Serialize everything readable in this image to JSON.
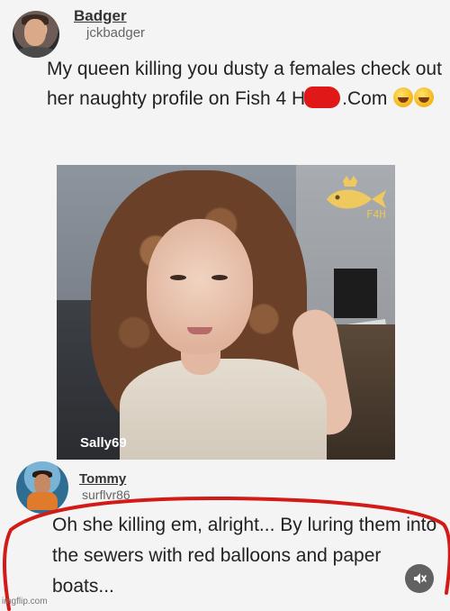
{
  "post": {
    "author": {
      "display_name": "Badger",
      "handle": "jckbadger"
    },
    "text_before_redaction": "My queen killing you dusty a females check out her naughty profile on Fish 4 H",
    "text_after_redaction": ".Com",
    "photo": {
      "username_label": "Sally69",
      "logo_text": "F4H",
      "logo_icon": "fish-crown-icon"
    }
  },
  "reply": {
    "author": {
      "display_name": "Tommy",
      "handle": "surflvr86"
    },
    "text": "Oh she killing em, alright... By luring them into the sewers with red balloons and paper boats..."
  },
  "overlay": {
    "highlight_color": "#d21b17",
    "mute_icon": "mute-icon"
  },
  "watermark": "imgflip.com"
}
